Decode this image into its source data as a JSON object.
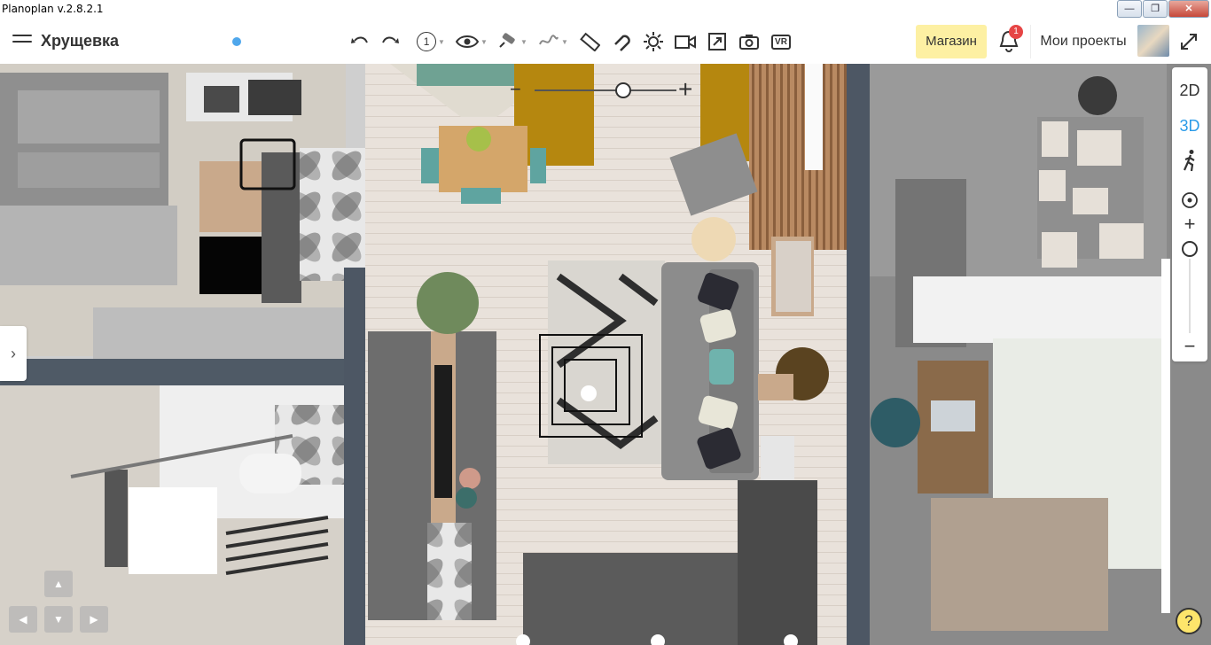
{
  "window": {
    "title": "Planoplan v.2.8.2.1",
    "buttons": [
      "—",
      "❐",
      "✕"
    ]
  },
  "header": {
    "project_title": "Хрущевка",
    "floor_number": "1",
    "shop_label": "Магазин",
    "notifications_count": "1",
    "projects_label": "Мои проекты",
    "accent_color": "#fdf0a3",
    "status_dot_color": "#4fa7ec"
  },
  "toolbar": {
    "icons": [
      "undo-icon",
      "redo-icon",
      "floor-selector",
      "eye-icon",
      "material-brush-icon",
      "wall-pattern-icon",
      "ruler-icon",
      "magnet-icon",
      "sun-icon",
      "video-camera-icon",
      "export-icon",
      "photo-camera-icon",
      "vr-icon"
    ],
    "vr_label": "VR"
  },
  "view_panel": {
    "mode_2d": "2D",
    "mode_3d": "3D",
    "active_mode": "3D",
    "active_color": "#2a9be8",
    "zoom_in": "+",
    "zoom_out": "−"
  },
  "help_label": "?",
  "side_toggle": "›",
  "slider": {
    "minus": "−",
    "plus": "+",
    "value_fraction": 0.62
  }
}
